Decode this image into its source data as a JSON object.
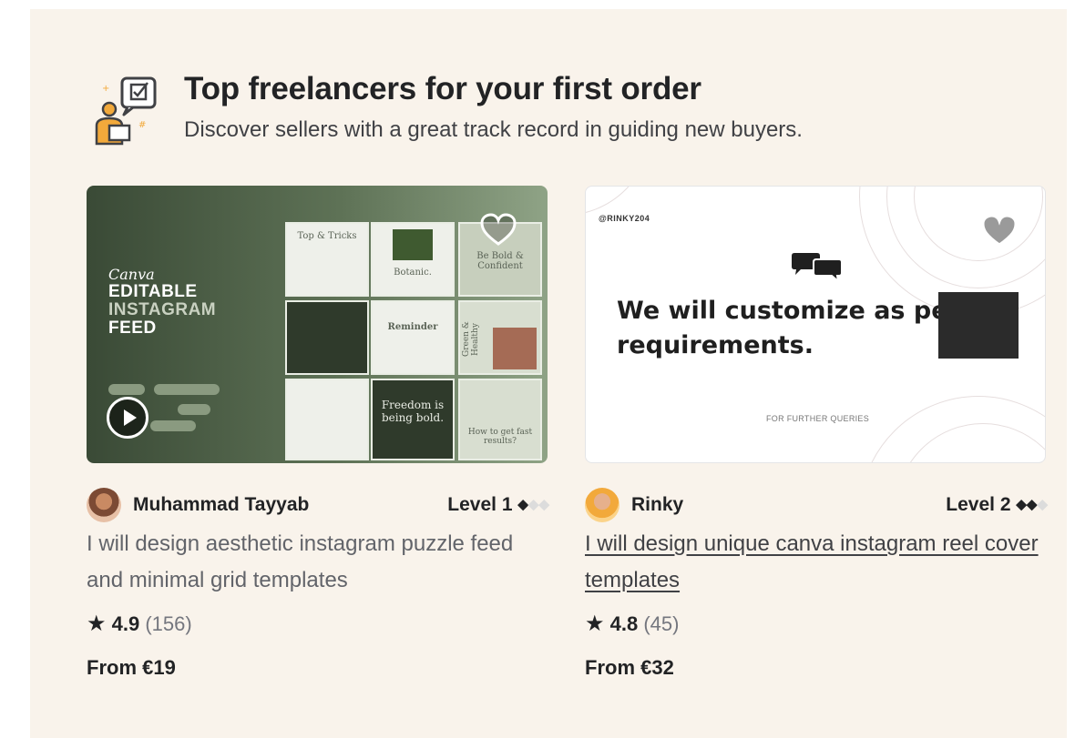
{
  "section": {
    "title": "Top freelancers for your first order",
    "subtitle": "Discover sellers with a great track record in guiding new buyers.",
    "icon": "freelancer-checklist-icon",
    "colors": {
      "background": "#f9f3eb",
      "text": "#222325",
      "muted": "#62646a",
      "accent": "#f2a93b"
    }
  },
  "cards": [
    {
      "thumbnail": {
        "script_text": "Canva",
        "line1": "EDITABLE",
        "line2": "INSTAGRAM",
        "line3": "FEED",
        "tile_top": "Top & Tricks",
        "tile_botanic": "Botanic.",
        "tile_bold": "Be Bold & Confident",
        "tile_reminder": "Reminder",
        "tile_green": "Green & Healthy",
        "tile_freedom": "Freedom is being bold.",
        "tile_howto": "How to get fast results?"
      },
      "seller_name": "Muhammad Tayyab",
      "level_label": "Level 1",
      "level_filled": 1,
      "level_total": 3,
      "title": "I will design aesthetic instagram puzzle feed and minimal grid templates",
      "rating": "4.9",
      "reviews": "(156)",
      "price": "From €19"
    },
    {
      "thumbnail": {
        "handle": "@RINKY204",
        "line1": "We will customize as pe",
        "line2": "requirements.",
        "queries": "FOR FURTHER QUERIES"
      },
      "seller_name": "Rinky",
      "level_label": "Level 2",
      "level_filled": 2,
      "level_total": 3,
      "title": "I will design unique canva instagram reel cover templates",
      "rating": "4.8",
      "reviews": "(45)",
      "price": "From €32"
    }
  ]
}
